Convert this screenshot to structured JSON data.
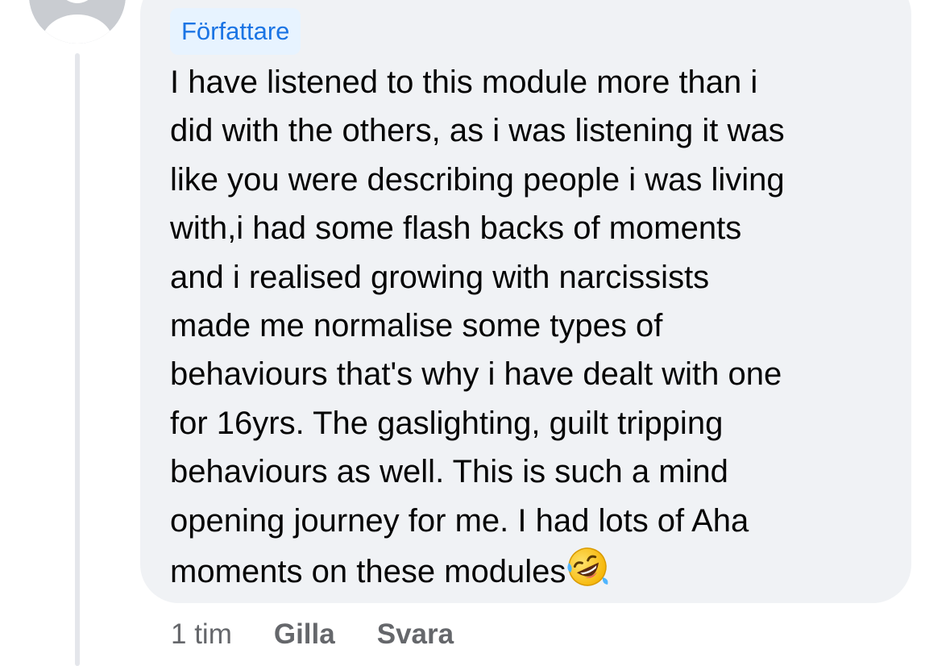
{
  "comment": {
    "author_badge": "Författare",
    "text": "I have listened to this module more than i\ndid with the others, as i was listening it was\nlike you were describing people i was living\nwith,i had some flash backs of moments\nand i realised growing with narcissists\nmade me normalise some types of\nbehaviours that's why i have dealt with one\nfor 16yrs. The gaslighting, guilt tripping\nbehaviours as well. This is such a mind\nopening journey for me. I had lots of Aha\nmoments on these modules",
    "emoji": "rolling-on-the-floor-laughing",
    "time": "1 tim",
    "like_label": "Gilla",
    "reply_label": "Svara"
  },
  "colors": {
    "bubble": "#f0f2f5",
    "badge_bg": "#e7f3ff",
    "badge_text": "#1b74e4",
    "meta_text": "#65676b",
    "avatar": "#dadde1",
    "thread_line": "#e4e6eb"
  }
}
